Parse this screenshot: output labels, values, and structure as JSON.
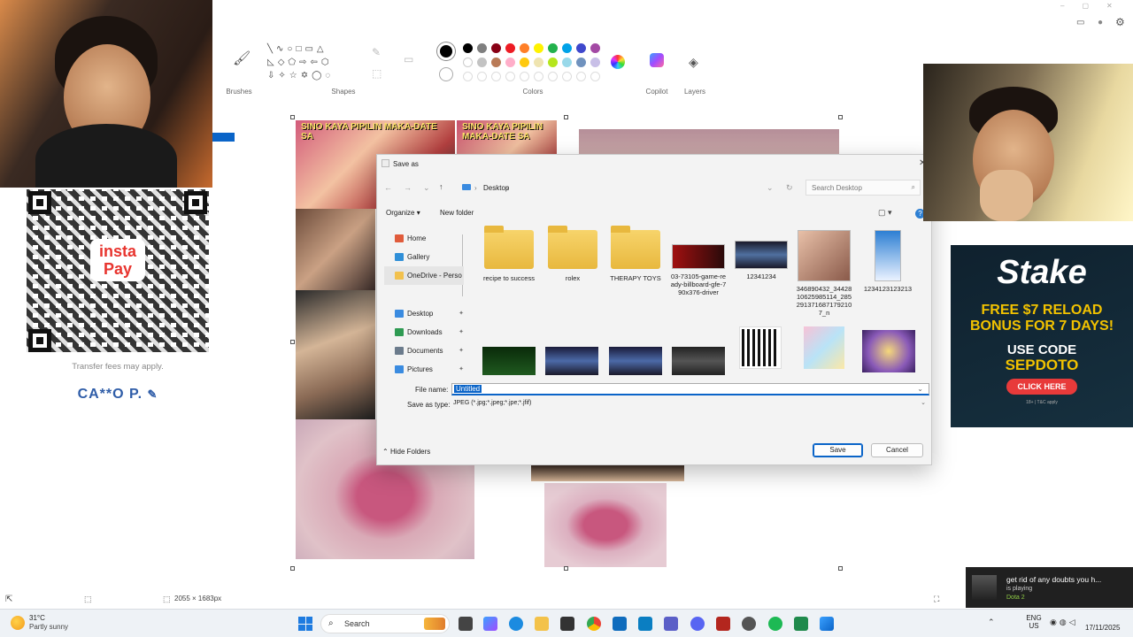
{
  "paint": {
    "sections": {
      "brushes": "Brushes",
      "shapes": "Shapes",
      "colors": "Colors",
      "copilot": "Copilot",
      "layers": "Layers"
    },
    "swatches_row1": [
      "#000000",
      "#7f7f7f",
      "#880015",
      "#ed1c24",
      "#ff7f27",
      "#fff200",
      "#22b14c",
      "#00a2e8",
      "#3f48cc",
      "#a349a4"
    ],
    "swatches_row2": [
      "#ffffff",
      "#c3c3c3",
      "#b97a57",
      "#ffaec9",
      "#ffc90e",
      "#efe4b0",
      "#b5e61d",
      "#99d9ea",
      "#7092be",
      "#c8bfe7"
    ],
    "status": {
      "size": "2055 × 1683px"
    }
  },
  "overlay": {
    "transfer_note": "Transfer fees may apply.",
    "account_name": "CA**O P.",
    "qr_brand_line1": "insta",
    "qr_brand_line2": "Pay",
    "thumb_text_1": "SINO KAYA PIPILIN MAKA-DATE SA",
    "thumb_text_2": "SINO KAYA PIPILIN MAKA-DATE SA"
  },
  "dialog": {
    "title": "Save as",
    "breadcrumb": "Desktop",
    "search_placeholder": "Search Desktop",
    "organize": "Organize",
    "new_folder": "New folder",
    "tree": [
      {
        "label": "Home",
        "color": "#e05b3b"
      },
      {
        "label": "Gallery",
        "color": "#2f8fd8"
      },
      {
        "label": "OneDrive - Perso",
        "color": "#f2c14e"
      },
      {
        "label": "Desktop",
        "color": "#3a8be0"
      },
      {
        "label": "Downloads",
        "color": "#2e9a52"
      },
      {
        "label": "Documents",
        "color": "#6b7b8c"
      },
      {
        "label": "Pictures",
        "color": "#3a8be0"
      }
    ],
    "files_row1": [
      {
        "name": "recipe to success",
        "kind": "folder"
      },
      {
        "name": "rolex",
        "kind": "folder"
      },
      {
        "name": "THERAPY TOYS",
        "kind": "folder"
      },
      {
        "name": "03-73105-game-ready-billboard-gfe-790x376-driver",
        "kind": "image"
      },
      {
        "name": "12341234",
        "kind": "image"
      },
      {
        "name": "346890432_3442810625985114_2852913716871792107_n",
        "kind": "image"
      },
      {
        "name": "1234123123213",
        "kind": "image"
      }
    ],
    "file_name_label": "File name:",
    "file_name_value": "Untitled",
    "save_type_label": "Save as type:",
    "save_type_value": "JPEG (*.jpg;*.jpeg;*.jpe;*.jfif)",
    "hide_folders": "Hide Folders",
    "save": "Save",
    "cancel": "Cancel"
  },
  "stake": {
    "logo": "Stake",
    "headline": "FREE $7 RELOAD BONUS FOR 7 DAYS!",
    "use_code": "USE CODE",
    "code": "SEPDOTO",
    "cta": "CLICK HERE",
    "fine": "18+ | T&C apply"
  },
  "notification": {
    "title": "get rid of any doubts you h...",
    "subtitle": "is playing",
    "game": "Dota 2"
  },
  "taskbar": {
    "weather_temp": "31°C",
    "weather_desc": "Partly sunny",
    "search": "Search",
    "lang_top": "ENG",
    "lang_bottom": "US",
    "date": "17/11/2025"
  }
}
